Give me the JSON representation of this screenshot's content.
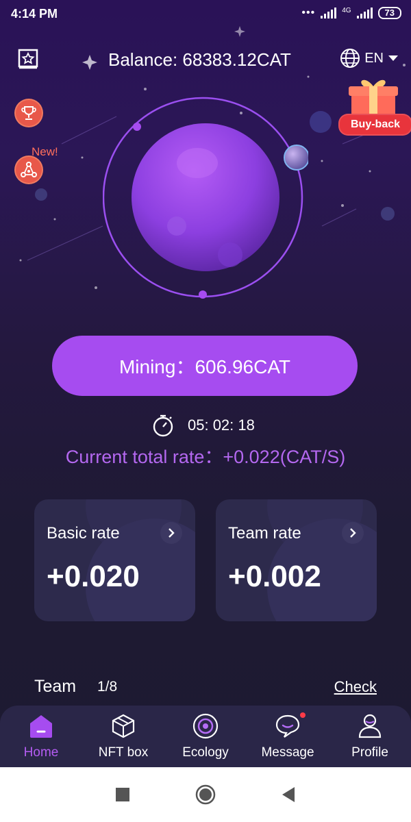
{
  "status_bar": {
    "time": "4:14 PM",
    "network": "4G",
    "battery": "73"
  },
  "header": {
    "balance": "Balance: 68383.12CAT",
    "language": "EN"
  },
  "side": {
    "new_label": "New!"
  },
  "promo": {
    "buyback_label": "Buy-back"
  },
  "mining": {
    "button_label": "Mining：606.96CAT",
    "timer": "05: 02: 18",
    "total_rate": "Current total rate：+0.022(CAT/S)"
  },
  "cards": [
    {
      "label": "Basic rate",
      "value": "+0.020"
    },
    {
      "label": "Team rate",
      "value": "+0.002"
    }
  ],
  "team": {
    "label": "Team",
    "count": "1/8",
    "check_label": "Check"
  },
  "nav": [
    {
      "label": "Home",
      "icon": "home-icon",
      "active": true
    },
    {
      "label": "NFT box",
      "icon": "box-icon"
    },
    {
      "label": "Ecology",
      "icon": "ecology-icon"
    },
    {
      "label": "Message",
      "icon": "message-icon",
      "badge": true
    },
    {
      "label": "Profile",
      "icon": "profile-icon"
    }
  ],
  "colors": {
    "accent": "#a64cf0",
    "rate_text": "#b468f0",
    "badge": "#ff3b48",
    "buyback": "#e8343c"
  },
  "system_nav": [
    "square-icon",
    "circle-icon",
    "back-triangle-icon"
  ]
}
